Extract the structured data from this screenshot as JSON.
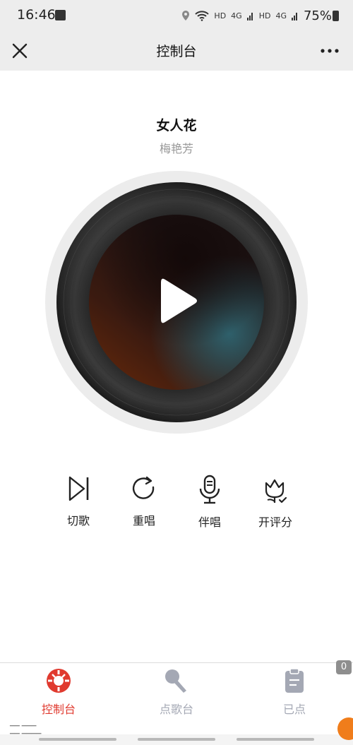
{
  "status_bar": {
    "time": "16:46",
    "network_1": "HD",
    "signal_1": "4G",
    "network_2": "HD",
    "signal_2": "4G",
    "battery": "75%"
  },
  "header": {
    "title": "控制台"
  },
  "song": {
    "title": "女人花",
    "artist": "梅艳芳"
  },
  "controls": [
    {
      "label": "切歌",
      "icon": "skip-next-icon"
    },
    {
      "label": "重唱",
      "icon": "replay-icon"
    },
    {
      "label": "伴唱",
      "icon": "microphone-icon"
    },
    {
      "label": "开评分",
      "icon": "flower-check-icon"
    }
  ],
  "tabs": [
    {
      "label": "控制台",
      "icon": "console-icon",
      "active": true
    },
    {
      "label": "点歌台",
      "icon": "mic-request-icon",
      "active": false
    },
    {
      "label": "已点",
      "icon": "clipboard-icon",
      "active": false
    }
  ],
  "badge_count": "0",
  "colors": {
    "accent": "#e03a2f",
    "inactive": "#a4a8b4",
    "bar_background": "#ededed"
  }
}
